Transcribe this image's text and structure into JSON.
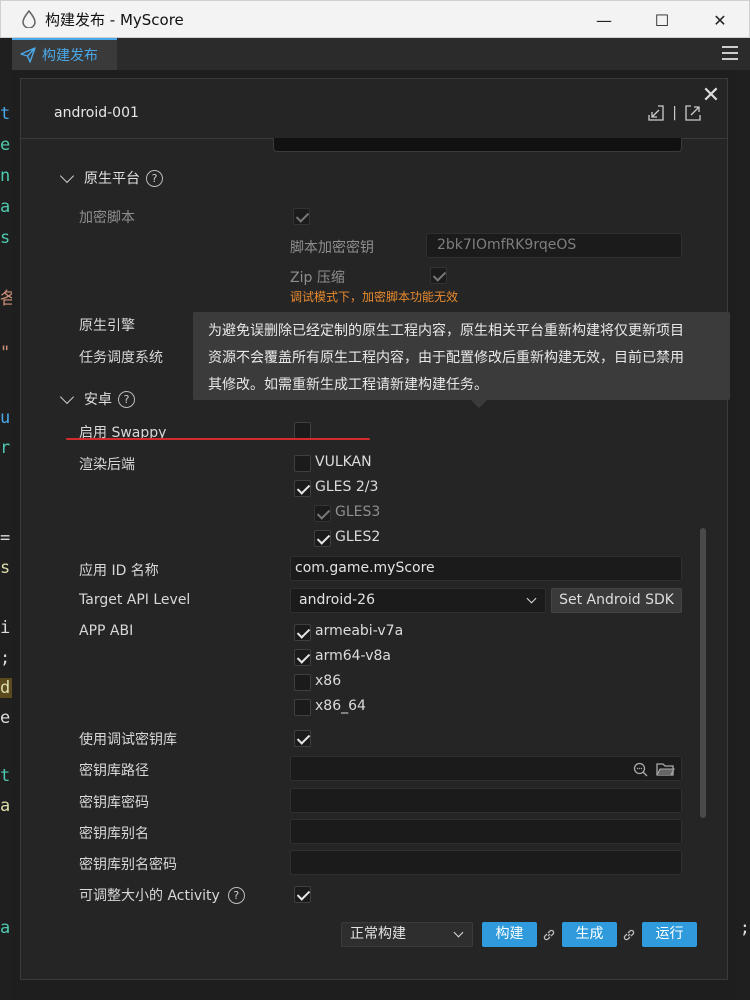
{
  "window": {
    "title": "构建发布 - MyScore",
    "minimize": "—",
    "maximize": "☐",
    "close": "✕"
  },
  "tab": {
    "label": "构建发布"
  },
  "panel": {
    "title": "android-001"
  },
  "editor_strip": [
    "t",
    "e",
    "n",
    "a",
    "s",
    "各",
    "\"",
    "u",
    "r",
    "=",
    "s",
    "i",
    ";",
    "d",
    "e",
    "t",
    "a",
    "a"
  ],
  "right_strip": [
    ";"
  ],
  "native": {
    "section": "原生平台",
    "encrypt_label": "加密脚本",
    "encrypt_checked": true,
    "key_label": "脚本加密密钥",
    "key_value": "2bk7IOmfRK9rqeOS",
    "zip_label": "Zip 压缩",
    "zip_checked": true,
    "warning": "调试模式下，加密脚本功能无效",
    "engine_label": "原生引擎",
    "scheduler_label": "任务调度系统"
  },
  "tooltip": {
    "lines": [
      "为避免误删除已经定制的原生工程内容，原生相关平台重新构建将仅更新项目",
      "资源不会覆盖所有原生工程内容，由于配置修改后重新构建无效，目前已禁用",
      "其修改。如需重新生成工程请新建构建任务。"
    ]
  },
  "android": {
    "section": "安卓",
    "swappy_label": "启用 Swappy",
    "swappy_checked": false,
    "render_label": "渲染后端",
    "render_options": [
      {
        "label": "VULKAN",
        "checked": false
      },
      {
        "label": "GLES 2/3",
        "checked": true
      },
      {
        "label": "GLES3",
        "checked": true
      },
      {
        "label": "GLES2",
        "checked": true
      }
    ],
    "app_id_label": "应用 ID 名称",
    "app_id_value": "com.game.myScore",
    "api_label": "Target API Level",
    "api_value": "android-26",
    "sdk_button": "Set Android SDK",
    "abi_label": "APP ABI",
    "abi_options": [
      {
        "label": "armeabi-v7a",
        "checked": true
      },
      {
        "label": "arm64-v8a",
        "checked": true
      },
      {
        "label": "x86",
        "checked": false
      },
      {
        "label": "x86_64",
        "checked": false
      }
    ],
    "debug_keystore_label": "使用调试密钥库",
    "debug_keystore_checked": true,
    "keystore_path_label": "密钥库路径",
    "keystore_password_label": "密钥库密码",
    "keystore_alias_label": "密钥库别名",
    "alias_password_label": "密钥库别名密码",
    "resizable_label": "可调整大小的 Activity",
    "resizable_checked": true
  },
  "footer": {
    "build_mode": "正常构建",
    "build_button": "构建",
    "make_button": "生成",
    "run_button": "运行"
  },
  "colors": {
    "accent": "#2f9bdc",
    "warning": "#e88a2e",
    "underline": "#d32b2b"
  }
}
